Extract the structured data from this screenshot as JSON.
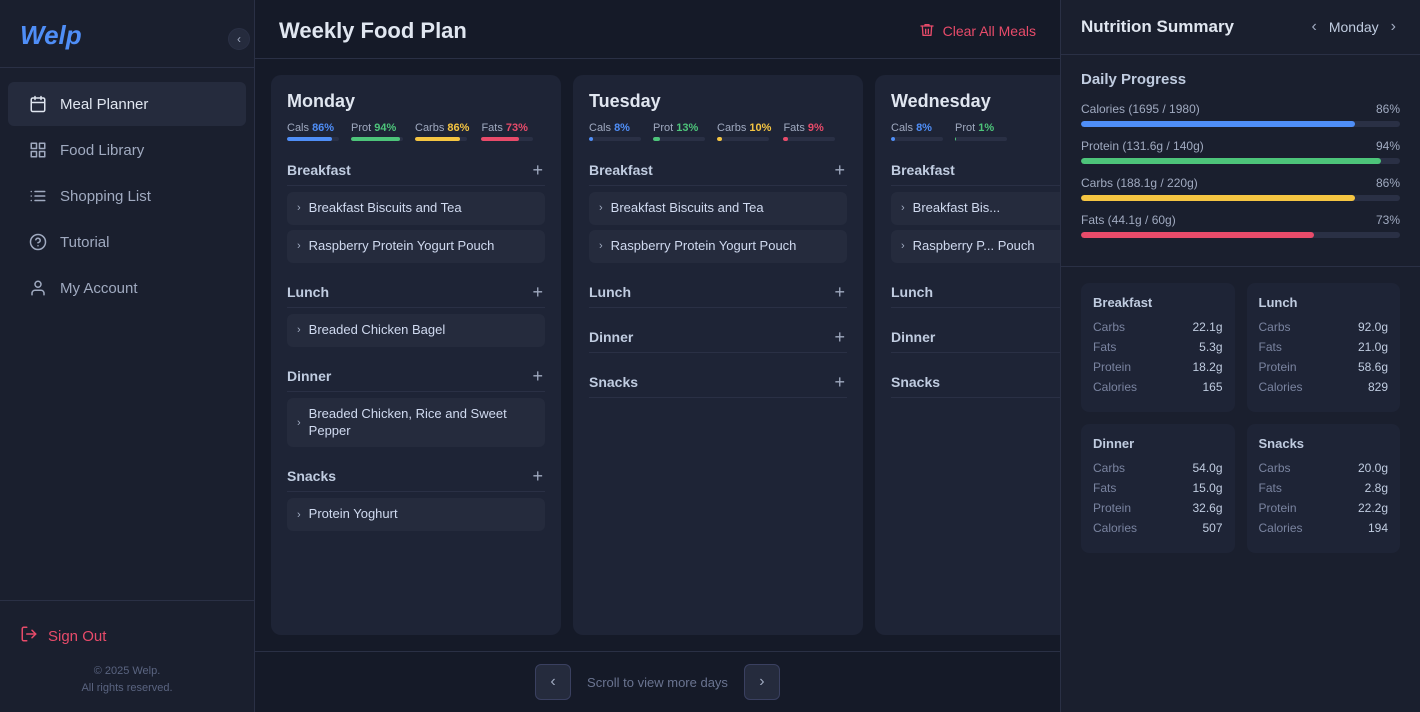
{
  "app": {
    "name": "Welp"
  },
  "sidebar": {
    "collapse_btn": "‹",
    "nav_items": [
      {
        "id": "meal-planner",
        "label": "Meal Planner",
        "icon": "calendar",
        "active": true
      },
      {
        "id": "food-library",
        "label": "Food Library",
        "icon": "grid"
      },
      {
        "id": "shopping-list",
        "label": "Shopping List",
        "icon": "list"
      },
      {
        "id": "tutorial",
        "label": "Tutorial",
        "icon": "help-circle"
      },
      {
        "id": "my-account",
        "label": "My Account",
        "icon": "user"
      }
    ],
    "sign_out": "Sign Out",
    "copyright_line1": "© 2025 Welp.",
    "copyright_line2": "All rights reserved."
  },
  "main": {
    "title": "Weekly Food Plan",
    "clear_meals_btn": "Clear All Meals",
    "days": [
      {
        "name": "Monday",
        "stats": [
          {
            "label": "Cals",
            "pct": "86%",
            "type": "cals"
          },
          {
            "label": "Prot",
            "pct": "94%",
            "type": "prot"
          },
          {
            "label": "Carbs",
            "pct": "86%",
            "type": "carbs"
          },
          {
            "label": "Fats",
            "pct": "73%",
            "type": "fats"
          }
        ],
        "meals": [
          {
            "name": "Breakfast",
            "items": [
              {
                "name": "Breakfast Biscuits and Tea"
              },
              {
                "name": "Raspberry Protein Yogurt Pouch"
              }
            ]
          },
          {
            "name": "Lunch",
            "items": [
              {
                "name": "Breaded Chicken Bagel"
              }
            ]
          },
          {
            "name": "Dinner",
            "items": [
              {
                "name": "Breaded Chicken, Rice and Sweet Pepper"
              }
            ]
          },
          {
            "name": "Snacks",
            "items": [
              {
                "name": "Protein Yoghurt"
              }
            ]
          }
        ]
      },
      {
        "name": "Tuesday",
        "stats": [
          {
            "label": "Cals",
            "pct": "8%",
            "type": "cals"
          },
          {
            "label": "Prot",
            "pct": "13%",
            "type": "prot"
          },
          {
            "label": "Carbs",
            "pct": "10%",
            "type": "carbs"
          },
          {
            "label": "Fats",
            "pct": "9%",
            "type": "fats"
          }
        ],
        "meals": [
          {
            "name": "Breakfast",
            "items": [
              {
                "name": "Breakfast Biscuits and Tea"
              },
              {
                "name": "Raspberry Protein Yogurt Pouch"
              }
            ]
          },
          {
            "name": "Lunch",
            "items": []
          },
          {
            "name": "Dinner",
            "items": []
          },
          {
            "name": "Snacks",
            "items": []
          }
        ]
      },
      {
        "name": "Wednesday",
        "stats": [
          {
            "label": "Cals",
            "pct": "8%",
            "type": "cals"
          },
          {
            "label": "Prot",
            "pct": "1%",
            "type": "prot"
          }
        ],
        "meals": [
          {
            "name": "Breakfast",
            "items": [
              {
                "name": "Breakfast Bis..."
              },
              {
                "name": "Raspberry P... Pouch"
              }
            ]
          },
          {
            "name": "Lunch",
            "items": []
          },
          {
            "name": "Dinner",
            "items": []
          },
          {
            "name": "Snacks",
            "items": []
          }
        ]
      }
    ],
    "scroll_label": "Scroll to view more days",
    "scroll_prev": "‹",
    "scroll_next": "›"
  },
  "nutrition": {
    "title": "Nutrition Summary",
    "day": "Monday",
    "nav_prev": "‹",
    "nav_next": "›",
    "daily_progress_title": "Daily Progress",
    "progress_items": [
      {
        "label": "Calories (1695 / 1980)",
        "pct": 86,
        "pct_label": "86%",
        "fill": "blue"
      },
      {
        "label": "Protein (131.6g / 140g)",
        "pct": 94,
        "pct_label": "94%",
        "fill": "green"
      },
      {
        "label": "Carbs (188.1g / 220g)",
        "pct": 86,
        "pct_label": "86%",
        "fill": "yellow"
      },
      {
        "label": "Fats (44.1g / 60g)",
        "pct": 73,
        "pct_label": "73%",
        "fill": "red"
      }
    ],
    "breakdown": [
      {
        "title": "Breakfast",
        "rows": [
          {
            "key": "Carbs",
            "val": "22.1g"
          },
          {
            "key": "Fats",
            "val": "5.3g"
          },
          {
            "key": "Protein",
            "val": "18.2g"
          },
          {
            "key": "Calories",
            "val": "165"
          }
        ]
      },
      {
        "title": "Lunch",
        "rows": [
          {
            "key": "Carbs",
            "val": "92.0g"
          },
          {
            "key": "Fats",
            "val": "21.0g"
          },
          {
            "key": "Protein",
            "val": "58.6g"
          },
          {
            "key": "Calories",
            "val": "829"
          }
        ]
      },
      {
        "title": "Dinner",
        "rows": [
          {
            "key": "Carbs",
            "val": "54.0g"
          },
          {
            "key": "Fats",
            "val": "15.0g"
          },
          {
            "key": "Protein",
            "val": "32.6g"
          },
          {
            "key": "Calories",
            "val": "507"
          }
        ]
      },
      {
        "title": "Snacks",
        "rows": [
          {
            "key": "Carbs",
            "val": "20.0g"
          },
          {
            "key": "Fats",
            "val": "2.8g"
          },
          {
            "key": "Protein",
            "val": "22.2g"
          },
          {
            "key": "Calories",
            "val": "194"
          }
        ]
      }
    ]
  }
}
